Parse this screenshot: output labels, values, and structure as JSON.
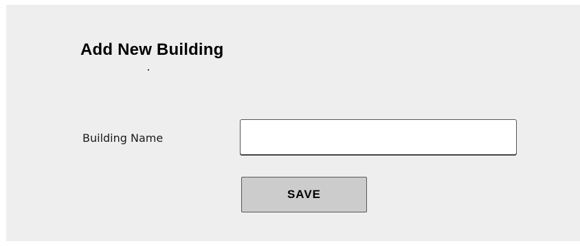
{
  "form": {
    "title": "Add New Building",
    "building_name": {
      "label": "Building Name",
      "value": "",
      "placeholder": ""
    },
    "save_label": "SAVE"
  },
  "colors": {
    "panel_background": "#eeeeee",
    "button_background": "#cccccc",
    "border": "#555555"
  }
}
